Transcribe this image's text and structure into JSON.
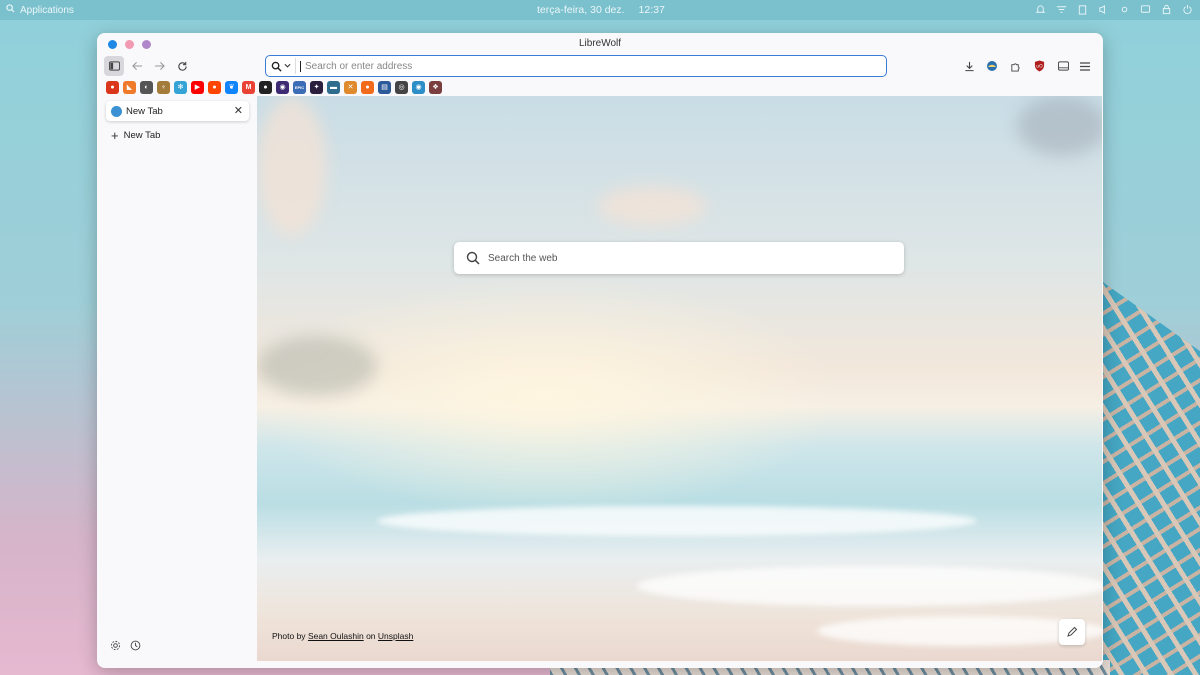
{
  "desktop": {
    "applications_label": "Applications",
    "date": "terça-feira, 30 dez.",
    "time": "12:37",
    "tray_icons": [
      "bell-icon",
      "network-icon",
      "clipboard-icon",
      "volume-icon",
      "brightness-icon",
      "chat-icon",
      "lock-icon",
      "power-icon"
    ]
  },
  "window": {
    "title": "LibreWolf",
    "traffic_lights": [
      "#1e88e5",
      "#f29ab2",
      "#b088c9"
    ]
  },
  "urlbar": {
    "placeholder": "Search or enter address",
    "value": ""
  },
  "toolbar_right": [
    "downloads-icon",
    "account-icon",
    "extensions-icon",
    "ublock-icon",
    "sidebar-toggle-icon",
    "menu-icon"
  ],
  "bookmarks": [
    {
      "name": "librewolf",
      "color": "#d9361b",
      "glyph": "●"
    },
    {
      "name": "bookmark-2",
      "color": "#ef7a2b",
      "glyph": "◣"
    },
    {
      "name": "bookmark-3",
      "color": "#555555",
      "glyph": "◐"
    },
    {
      "name": "bookmark-4",
      "color": "#a47c3a",
      "glyph": "♆"
    },
    {
      "name": "bookmark-5",
      "color": "#36a3d6",
      "glyph": "✻"
    },
    {
      "name": "youtube",
      "color": "#ff0000",
      "glyph": "▶"
    },
    {
      "name": "reddit",
      "color": "#ff4500",
      "glyph": "●"
    },
    {
      "name": "bluesky",
      "color": "#1185fe",
      "glyph": "❦"
    },
    {
      "name": "gmail",
      "color": "#ea4335",
      "glyph": "M"
    },
    {
      "name": "github",
      "color": "#222222",
      "glyph": "●"
    },
    {
      "name": "bookmark-11",
      "color": "#3d2a73",
      "glyph": "◉"
    },
    {
      "name": "epic-games",
      "color": "#3a6db5",
      "glyph": "EPIC"
    },
    {
      "name": "bookmark-13",
      "color": "#2c1f3d",
      "glyph": "✦"
    },
    {
      "name": "bookmark-14",
      "color": "#2f6d8f",
      "glyph": "▬"
    },
    {
      "name": "bookmark-15",
      "color": "#e08a2e",
      "glyph": "✕"
    },
    {
      "name": "bookmark-16",
      "color": "#f26b1d",
      "glyph": "●"
    },
    {
      "name": "bookmark-17",
      "color": "#2d5b9a",
      "glyph": "▤"
    },
    {
      "name": "globe",
      "color": "#444444",
      "glyph": "◎"
    },
    {
      "name": "bookmark-19",
      "color": "#2c8ec7",
      "glyph": "◉"
    },
    {
      "name": "bookmark-20",
      "color": "#7a3e3e",
      "glyph": "❖"
    }
  ],
  "sidebar": {
    "tabs": [
      {
        "label": "New Tab"
      }
    ],
    "new_tab_label": "New Tab"
  },
  "newtab_page": {
    "search_placeholder": "Search the web",
    "credit_prefix": "Photo by",
    "credit_author": "Sean Oulashin",
    "credit_on": "on",
    "credit_site": "Unsplash"
  }
}
